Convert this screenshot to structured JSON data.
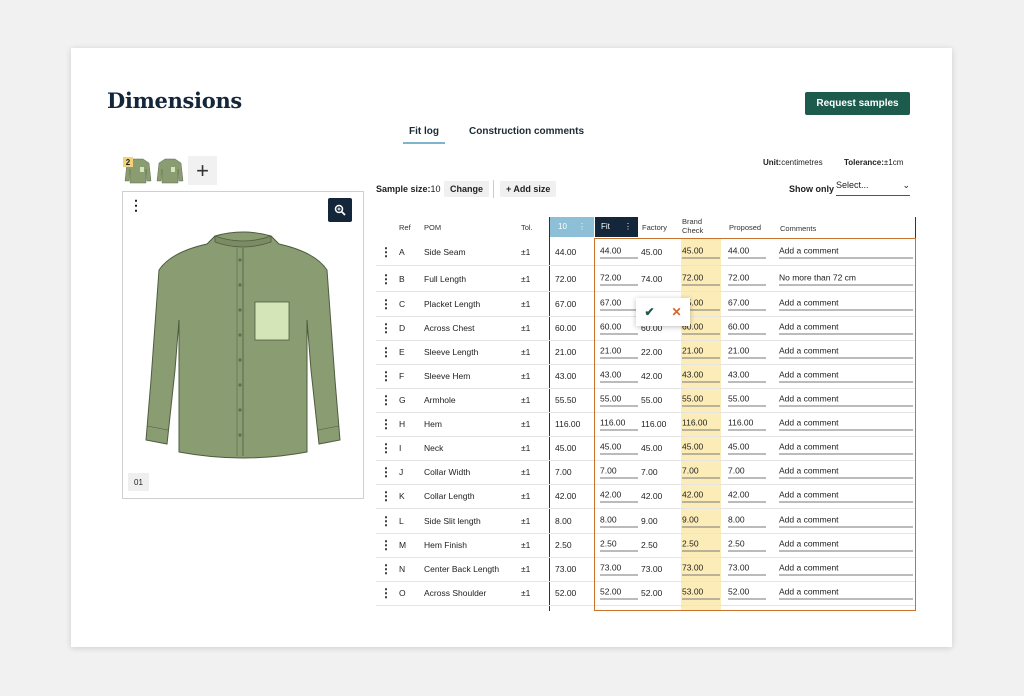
{
  "page": {
    "title": "Dimensions",
    "request_button": "Request samples"
  },
  "tabs": [
    {
      "label": "Fit log",
      "active": true
    },
    {
      "label": "Construction comments",
      "active": false
    }
  ],
  "thumbnails": {
    "badge": "2",
    "image_index": "01"
  },
  "unit": {
    "label": "Unit:",
    "value": "centimetres"
  },
  "tolerance": {
    "label": "Tolerance:",
    "value": "±1cm"
  },
  "sample": {
    "label": "Sample size:",
    "value": "10",
    "change_label": "Change",
    "add_size_label": "+ Add size"
  },
  "filter": {
    "label": "Show only",
    "placeholder": "Select..."
  },
  "columns": {
    "ref": "Ref",
    "pom": "POM",
    "tol": "Tol.",
    "size": "10",
    "fit": "Fit",
    "factory": "Factory",
    "brand_check_1": "Brand",
    "brand_check_2": "Check",
    "proposed": "Proposed",
    "comments": "Comments"
  },
  "rows": [
    {
      "ref": "A",
      "pom": "Side Seam",
      "tol": "±1",
      "size": "44.00",
      "fit": "44.00",
      "factory": "45.00",
      "brand": "45.00",
      "proposed": "44.00",
      "comment": "Add a comment"
    },
    {
      "ref": "B",
      "pom": "Full Length",
      "tol": "±1",
      "size": "72.00",
      "fit": "72.00",
      "factory": "74.00",
      "brand": "72.00",
      "proposed": "72.00",
      "comment": "No more than 72 cm"
    },
    {
      "ref": "C",
      "pom": "Placket Length",
      "tol": "±1",
      "size": "67.00",
      "fit": "67.00",
      "factory": "",
      "brand": "65.00",
      "proposed": "67.00",
      "comment": "Add a comment"
    },
    {
      "ref": "D",
      "pom": "Across Chest",
      "tol": "±1",
      "size": "60.00",
      "fit": "60.00",
      "factory": "60.00",
      "brand": "60.00",
      "proposed": "60.00",
      "comment": "Add a comment"
    },
    {
      "ref": "E",
      "pom": "Sleeve Length",
      "tol": "±1",
      "size": "21.00",
      "fit": "21.00",
      "factory": "22.00",
      "brand": "21.00",
      "proposed": "21.00",
      "comment": "Add a comment"
    },
    {
      "ref": "F",
      "pom": "Sleeve Hem",
      "tol": "±1",
      "size": "43.00",
      "fit": "43.00",
      "factory": "42.00",
      "brand": "43.00",
      "proposed": "43.00",
      "comment": "Add a comment"
    },
    {
      "ref": "G",
      "pom": "Armhole",
      "tol": "±1",
      "size": "55.50",
      "fit": "55.00",
      "factory": "55.00",
      "brand": "55.00",
      "proposed": "55.00",
      "comment": "Add a comment"
    },
    {
      "ref": "H",
      "pom": "Hem",
      "tol": "±1",
      "size": "116.00",
      "fit": "116.00",
      "factory": "116.00",
      "brand": "116.00",
      "proposed": "116.00",
      "comment": "Add a comment"
    },
    {
      "ref": "I",
      "pom": "Neck",
      "tol": "±1",
      "size": "45.00",
      "fit": "45.00",
      "factory": "45.00",
      "brand": "45.00",
      "proposed": "45.00",
      "comment": "Add a comment"
    },
    {
      "ref": "J",
      "pom": "Collar Width",
      "tol": "±1",
      "size": "7.00",
      "fit": "7.00",
      "factory": "7.00",
      "brand": "7.00",
      "proposed": "7.00",
      "comment": "Add a comment"
    },
    {
      "ref": "K",
      "pom": "Collar Length",
      "tol": "±1",
      "size": "42.00",
      "fit": "42.00",
      "factory": "42.00",
      "brand": "42.00",
      "proposed": "42.00",
      "comment": "Add a comment"
    },
    {
      "ref": "L",
      "pom": "Side Slit length",
      "tol": "±1",
      "size": "8.00",
      "fit": "8.00",
      "factory": "9.00",
      "brand": "9.00",
      "proposed": "8.00",
      "comment": "Add a comment"
    },
    {
      "ref": "M",
      "pom": "Hem Finish",
      "tol": "±1",
      "size": "2.50",
      "fit": "2.50",
      "factory": "2.50",
      "brand": "2.50",
      "proposed": "2.50",
      "comment": "Add a comment"
    },
    {
      "ref": "N",
      "pom": "Center Back Length",
      "tol": "±1",
      "size": "73.00",
      "fit": "73.00",
      "factory": "73.00",
      "brand": "73.00",
      "proposed": "73.00",
      "comment": "Add a comment"
    },
    {
      "ref": "O",
      "pom": "Across Shoulder",
      "tol": "±1",
      "size": "52.00",
      "fit": "52.00",
      "factory": "52.00",
      "brand": "53.00",
      "proposed": "52.00",
      "comment": "Add a comment"
    }
  ],
  "colors": {
    "accent": "#1d5b4d",
    "navy": "#13263a",
    "brand_check": "#fcecb8",
    "fit_outline": "#c9722e",
    "size_header": "#8dbfd6"
  },
  "icons": [
    "kebab-icon",
    "zoom-icon",
    "plus-icon",
    "check-icon",
    "close-icon",
    "chevron-down-icon"
  ]
}
